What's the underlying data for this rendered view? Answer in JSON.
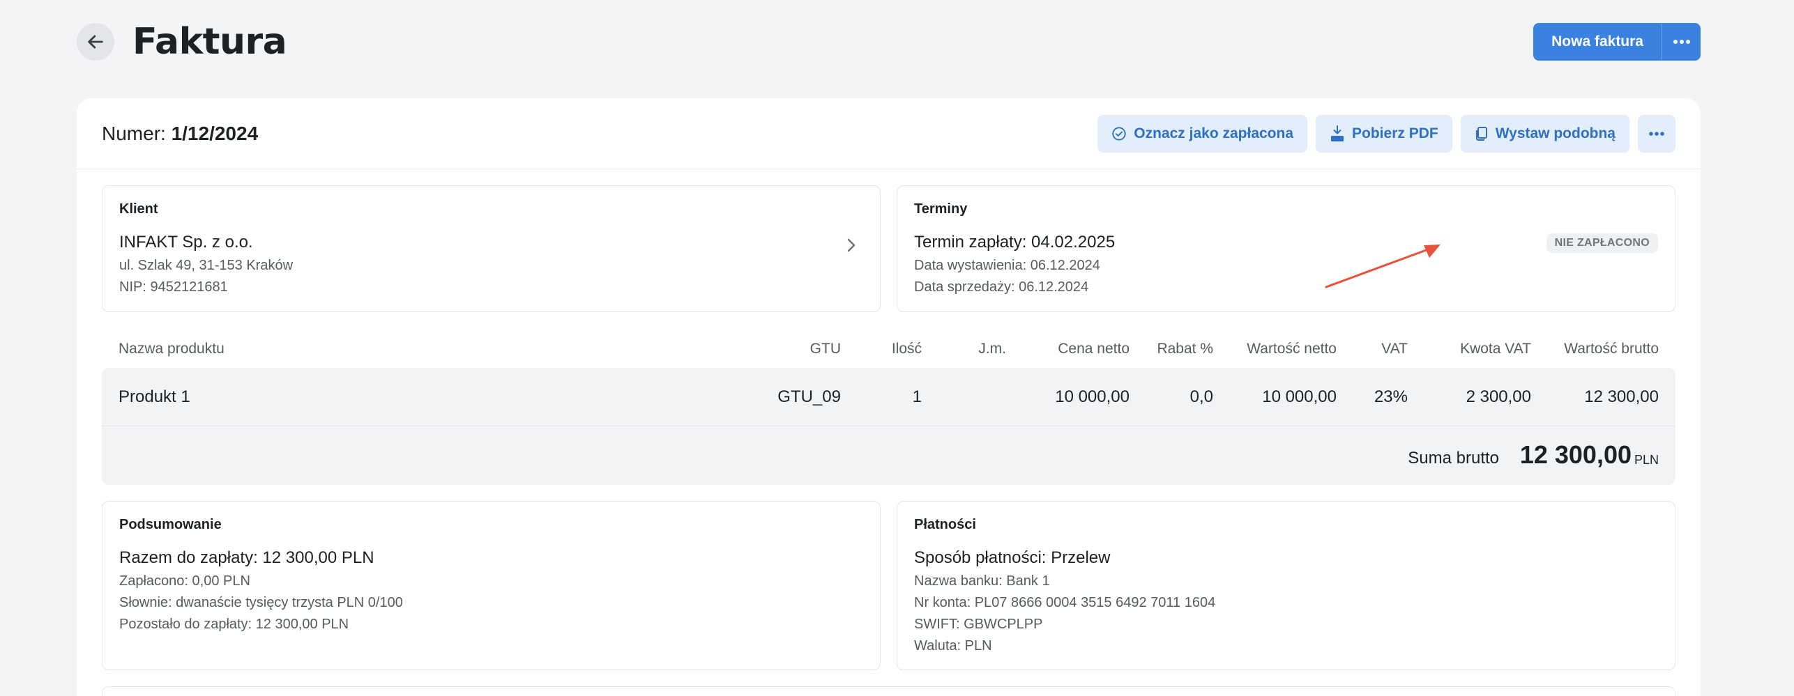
{
  "header": {
    "title": "Faktura",
    "new_invoice": "Nowa faktura"
  },
  "invoice": {
    "number_label": "Numer: ",
    "number": "1/12/2024",
    "actions": {
      "mark_paid": "Oznacz jako zapłacona",
      "download_pdf": "Pobierz PDF",
      "issue_similar": "Wystaw podobną"
    }
  },
  "client": {
    "title": "Klient",
    "name": "INFAKT Sp. z o.o.",
    "address": "ul. Szlak 49, 31-153 Kraków",
    "nip": "NIP: 9452121681"
  },
  "terms": {
    "title": "Terminy",
    "due": "Termin zapłaty: 04.02.2025",
    "issued": "Data wystawienia: 06.12.2024",
    "sale": "Data sprzedaży: 06.12.2024",
    "status": "NIE ZAPŁACONO"
  },
  "table": {
    "columns": [
      "Nazwa produktu",
      "GTU",
      "Ilość",
      "J.m.",
      "Cena netto",
      "Rabat %",
      "Wartość netto",
      "VAT",
      "Kwota VAT",
      "Wartość brutto"
    ],
    "rows": [
      [
        "Produkt 1",
        "GTU_09",
        "1",
        "",
        "10 000,00",
        "0,0",
        "10 000,00",
        "23%",
        "2 300,00",
        "12 300,00"
      ]
    ],
    "sum_label": "Suma brutto",
    "sum_value": "12 300,00",
    "sum_currency": "PLN"
  },
  "summary": {
    "title": "Podsumowanie",
    "total": "Razem do zapłaty: 12 300,00 PLN",
    "paid": "Zapłacono: 0,00 PLN",
    "words": "Słownie: dwanaście tysięcy trzysta PLN 0/100",
    "remaining": "Pozostało do zapłaty: 12 300,00 PLN"
  },
  "payments": {
    "title": "Płatności",
    "method": "Sposób płatności: Przelew",
    "bank": "Nazwa banku: Bank 1",
    "account": "Nr konta: PL07 8666 0004 3515 6492 7011 1604",
    "swift": "SWIFT: GBWCPLPP",
    "currency": "Waluta: PLN"
  },
  "colors": {
    "primary": "#3b82e0",
    "soft": "#e3eefb",
    "annotation_arrow": "#e8513a"
  }
}
